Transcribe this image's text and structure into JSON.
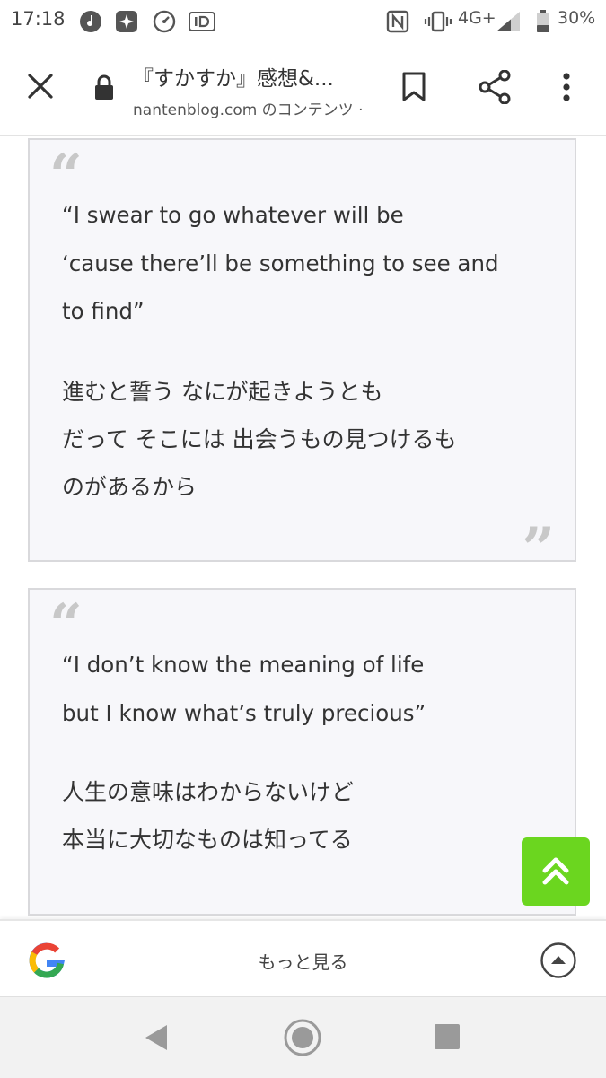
{
  "status_bar": {
    "time": "17:18",
    "left_icons": [
      "music-note-icon",
      "sparkle-icon",
      "speedometer-icon",
      "id-badge-icon"
    ],
    "right_icons": [
      "nfc-icon",
      "vibrate-icon",
      "signal-icon",
      "battery-icon"
    ],
    "network": "4G+",
    "battery": "30%"
  },
  "header": {
    "title": "『すかすか』感想&...",
    "url": "nantenblog.com のコンテンツ ·",
    "icons": [
      "close-icon",
      "lock-icon",
      "bookmark-icon",
      "share-icon",
      "more-vert-icon"
    ]
  },
  "quotes": [
    {
      "english": [
        "“I swear to go whatever will be",
        "‘cause there’ll be something to see and",
        "to find”"
      ],
      "japanese": [
        "進むと誓う なにが起きようとも",
        "だって そこには 出会うもの見つけるも",
        "のがあるから"
      ],
      "open_mark": "“",
      "close_mark": "”"
    },
    {
      "english": [
        "“I don’t know the meaning of life",
        "but I know what’s truly precious”"
      ],
      "japanese": [
        "人生の意味はわからないけど",
        "本当に大切なものは知ってる"
      ],
      "open_mark": "“"
    }
  ],
  "scroll_top_button": {
    "icon": "double-chevron-up-icon",
    "color": "#6bd61f"
  },
  "bottom_bar": {
    "icon": "google-g-icon",
    "label": "もっと見る",
    "expand_icon": "chevron-up-circle-icon"
  },
  "nav_bar": {
    "icons": [
      "back-triangle-icon",
      "home-circle-icon",
      "recents-square-icon"
    ]
  }
}
